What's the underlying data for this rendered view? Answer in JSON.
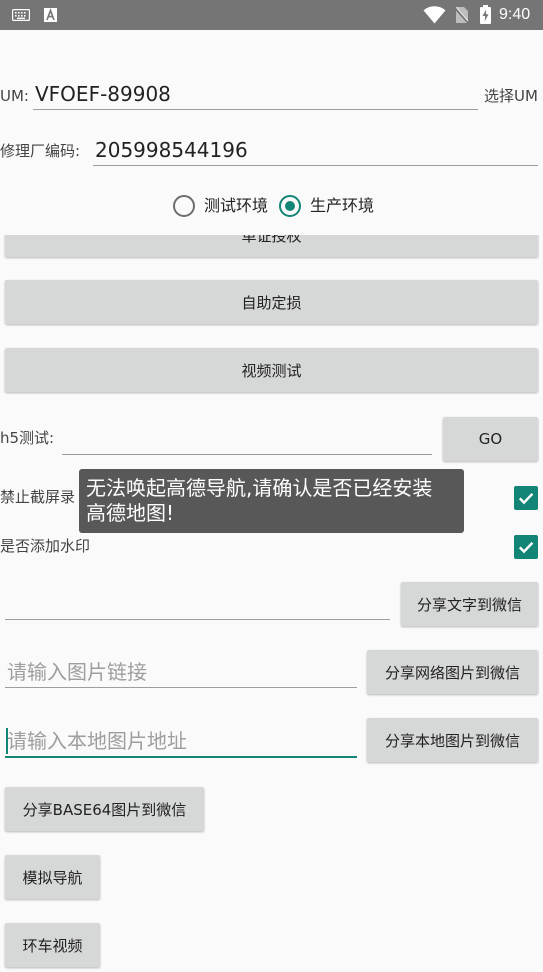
{
  "status_bar": {
    "time": "9:40",
    "icons_left": [
      "keyboard-icon",
      "a-icon"
    ],
    "icons_right": [
      "wifi-icon",
      "no-sim-icon",
      "battery-charging-icon"
    ]
  },
  "um": {
    "label": "UM:",
    "value": "VFOEF-89908",
    "select_label": "选择UM"
  },
  "repair_shop": {
    "label": "修理厂编码:",
    "value": "205998544196"
  },
  "environment": {
    "options": [
      {
        "label": "测试环境",
        "checked": false
      },
      {
        "label": "生产环境",
        "checked": true
      }
    ]
  },
  "buttons": {
    "doc_auth": "单证授权",
    "self_loss_assessment": "自助定损",
    "video_test": "视频测试",
    "share_base64": "分享BASE64图片到微信",
    "mock_navigation": "模拟导航",
    "car_video": "环车视频"
  },
  "h5": {
    "label": "h5测试:",
    "value": "",
    "go_label": "GO"
  },
  "forbid_screenshot": {
    "label": "禁止截屏录",
    "checked": true
  },
  "watermark": {
    "label": "是否添加水印",
    "checked": true
  },
  "share_text": {
    "value": "",
    "button": "分享文字到微信"
  },
  "share_net_image": {
    "placeholder": "请输入图片链接",
    "button": "分享网络图片到微信"
  },
  "share_local_image": {
    "placeholder": "请输入本地图片地址",
    "button": "分享本地图片到微信"
  },
  "toast": {
    "message": "无法唤起高德导航,请确认是否已经安装高德地图!"
  },
  "colors": {
    "accent": "#138577",
    "status_bar": "#757575",
    "button": "#d6d7d7",
    "toast": "#585858"
  }
}
